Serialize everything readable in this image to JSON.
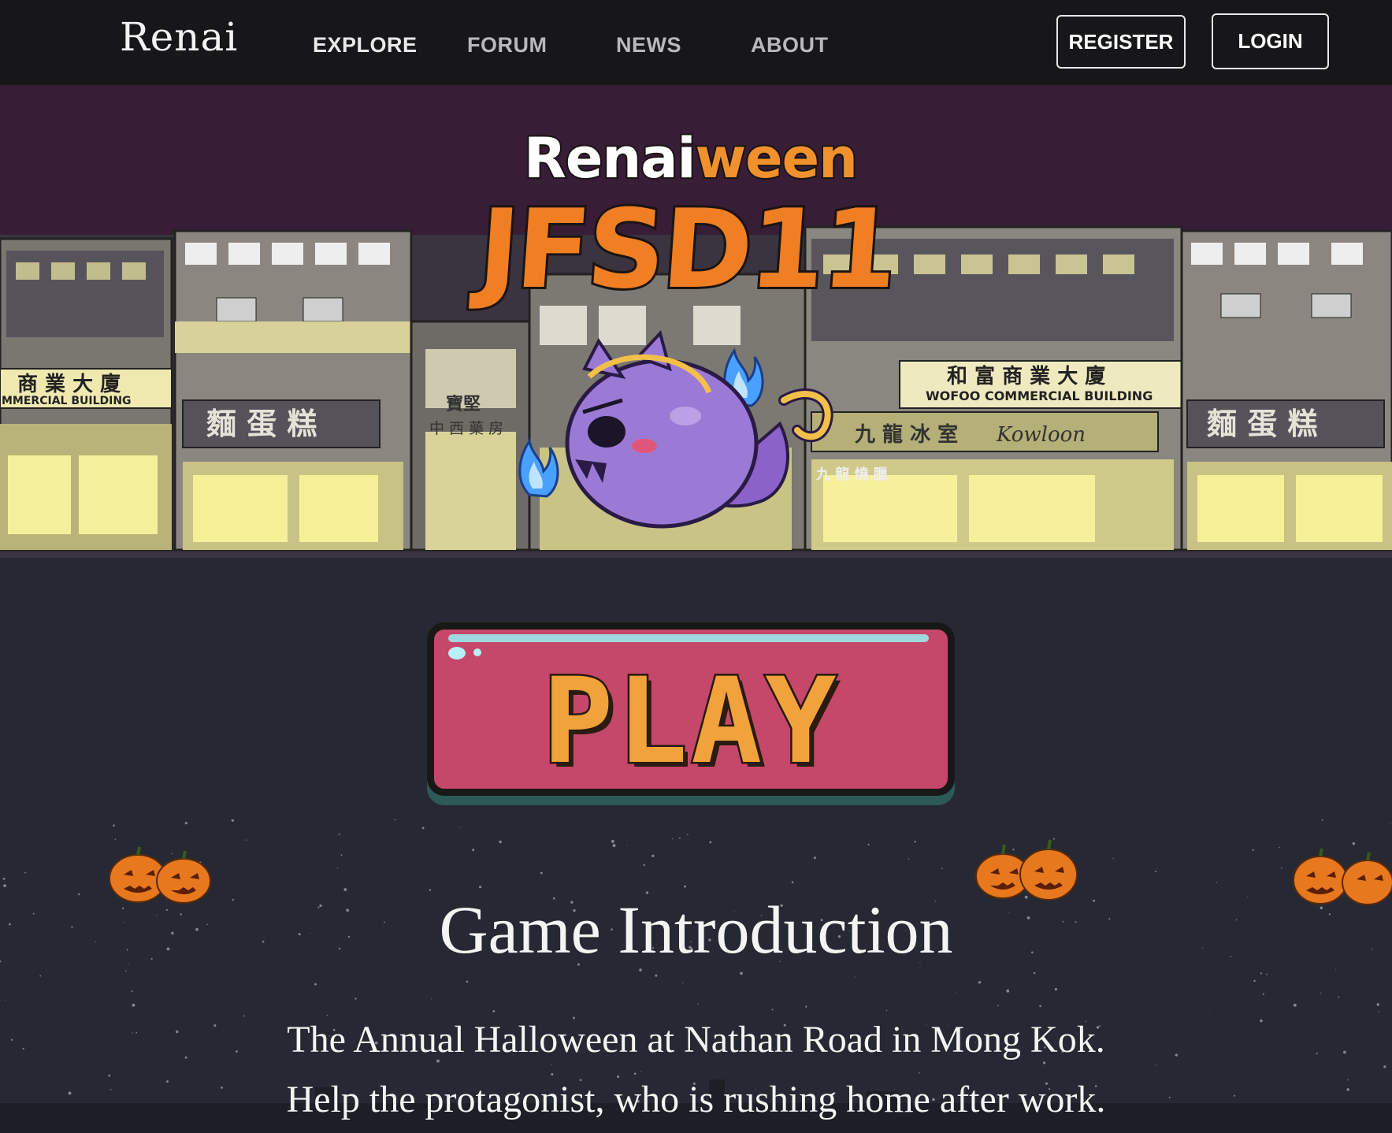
{
  "navbar": {
    "logo": "Renai",
    "links": [
      "EXPLORE",
      "FORUM",
      "NEWS",
      "ABOUT"
    ],
    "register": "REGISTER",
    "login": "LOGIN"
  },
  "hero": {
    "title_part1": "Renai",
    "title_part2": "ween",
    "subtitle": "JFSD11",
    "signs": {
      "building_left": "商 業 大 廈",
      "building_left_en": "MMERCIAL BUILDING",
      "cake": "麵 蛋 糕",
      "pharmacy": "寶堅",
      "pharmacy_sub": "中 西 藥 房",
      "building_right": "和 富 商 業 大 廈",
      "building_right_en": "WOFOO COMMERCIAL BUILDING",
      "shop_right": "九 龍 冰 室",
      "bbq": "九 龍 燒 臘",
      "shop_logo": "Kowloon"
    }
  },
  "play_button": "PLAY",
  "intro": {
    "heading": "Game Introduction",
    "line1": "The Annual Halloween at Nathan Road in Mong Kok.",
    "line2": "Help the protagonist, who is rushing home after work."
  },
  "colors": {
    "navbar_bg": "#171719",
    "hero_sky": "#371d35",
    "page_bg": "#262933",
    "accent_orange": "#ef7f22",
    "play_red": "#c54769",
    "ghost_purple": "#9b7ad6",
    "flame_blue": "#4aa0ff"
  },
  "icons": [
    "ghost-mascot-icon",
    "blue-flame-icon",
    "pumpkin-icon"
  ]
}
